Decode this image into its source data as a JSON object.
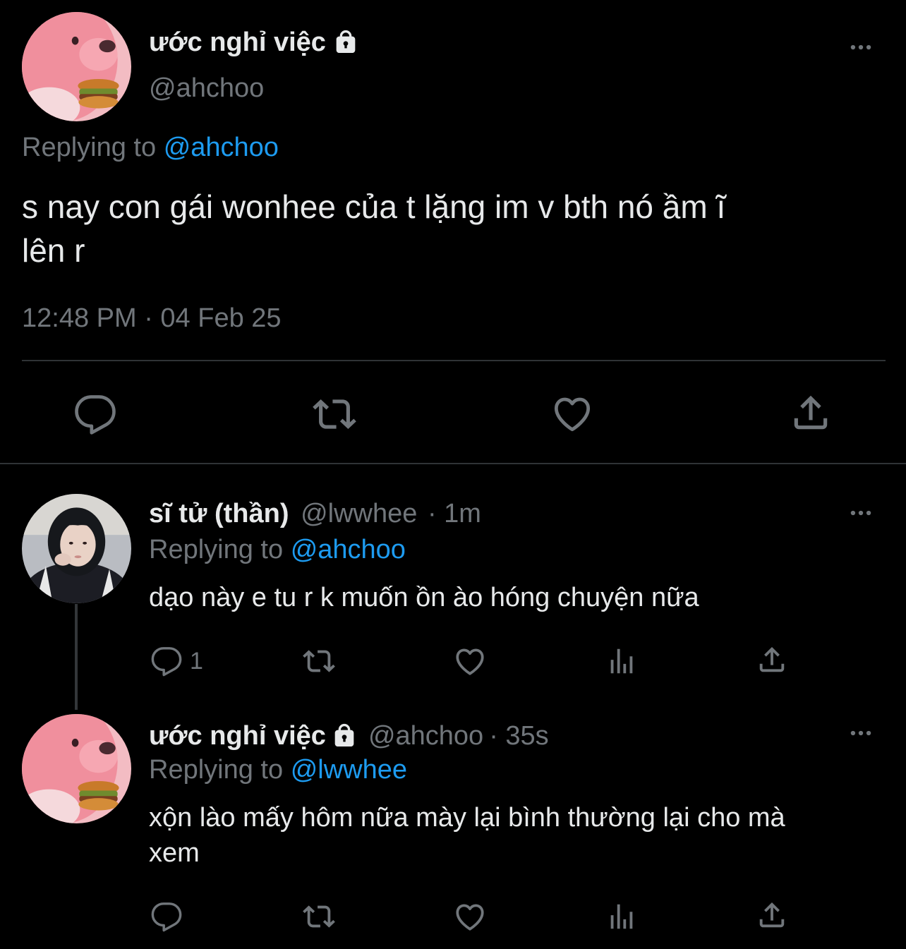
{
  "colors": {
    "background": "#000000",
    "text": "#e7e9ea",
    "muted": "#71767b",
    "link": "#1d9bf0",
    "divider": "#2f3336"
  },
  "main_tweet": {
    "display_name": "ước nghỉ việc",
    "protected_icon": "lock-icon",
    "handle": "@ahchoo",
    "replying_prefix": "Replying to",
    "replying_handle": "@ahchoo",
    "text_line1": "s nay con gái wonhee của t lặng im v bth nó ầm ĩ",
    "text_line2": "lên r",
    "timestamp": "12:48 PM · 04 Feb 25",
    "actions": [
      "reply-icon",
      "retweet-icon",
      "like-icon",
      "share-icon"
    ]
  },
  "replies": [
    {
      "display_name": "sĩ tử (thần)",
      "handle": "@lwwhee",
      "time": "· 1m",
      "replying_prefix": "Replying to",
      "replying_handle": "@ahchoo",
      "text_line1": "dạo này e tu r k muốn ồn ào hóng chuyện nữa",
      "reply_count": "1",
      "actions": [
        "reply-icon",
        "retweet-icon",
        "like-icon",
        "analytics-icon",
        "share-icon"
      ]
    },
    {
      "display_name": "ước nghỉ việc",
      "protected_icon": "lock-icon",
      "handle": "@ahchoo",
      "time": "· 35s",
      "replying_prefix": "Replying to",
      "replying_handle": "@lwwhee",
      "text_line1": "xộn lào mấy hôm nữa mày lại bình thường lại cho mà",
      "text_line2": "xem",
      "reply_count": "",
      "actions": [
        "reply-icon",
        "retweet-icon",
        "like-icon",
        "analytics-icon",
        "share-icon"
      ]
    }
  ]
}
